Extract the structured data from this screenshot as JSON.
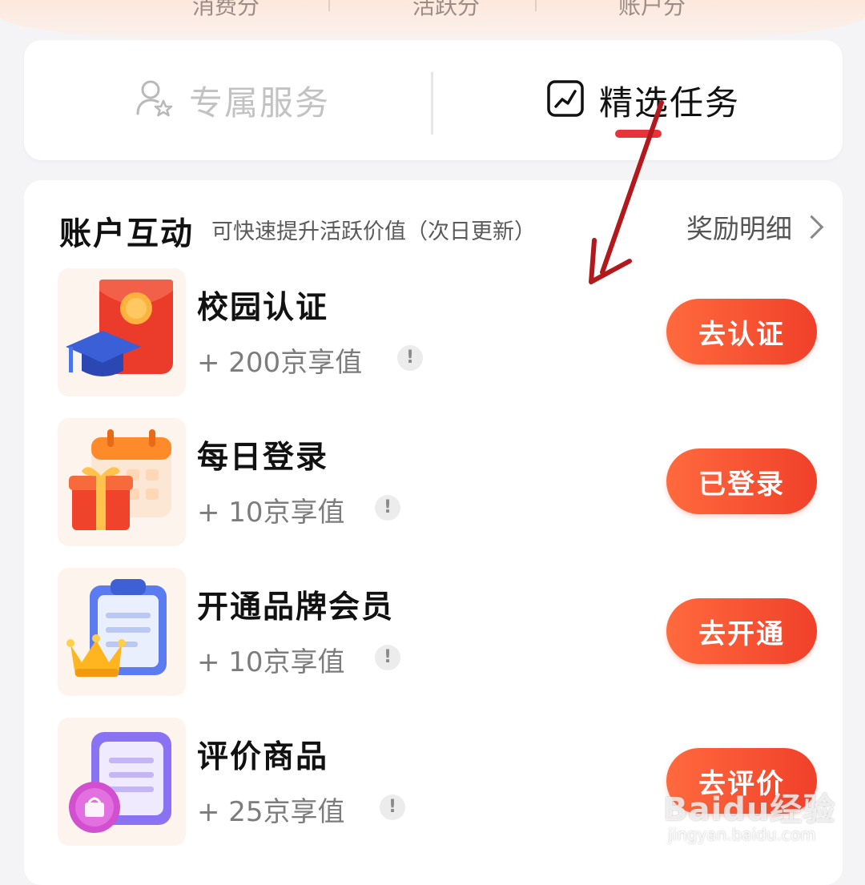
{
  "top_strip": {
    "partial_labels": [
      "消费分",
      "活跃分",
      "账户分"
    ]
  },
  "tabs": [
    {
      "label": "专属服务",
      "icon": "person-star-icon",
      "active": false
    },
    {
      "label": "精选任务",
      "icon": "chart-line-icon",
      "active": true
    }
  ],
  "section": {
    "title": "账户互动",
    "subtitle": "可快速提升活跃价值（次日更新）",
    "reward_link": "奖励明细"
  },
  "tasks": [
    {
      "title": "校园认证",
      "value": "+ 200京享值",
      "button": "去认证",
      "icon": "graduation-cap-red-envelope-icon"
    },
    {
      "title": "每日登录",
      "value": "+ 10京享值",
      "button": "已登录",
      "icon": "calendar-gift-icon"
    },
    {
      "title": "开通品牌会员",
      "value": "+ 10京享值",
      "button": "去开通",
      "icon": "clipboard-crown-icon"
    },
    {
      "title": "评价商品",
      "value": "+ 25京享值",
      "button": "去评价",
      "icon": "document-bag-badge-icon"
    }
  ],
  "watermark": {
    "main": "Baidu经验",
    "sub": "jingyan.baidu.com"
  },
  "colors": {
    "accent": "#f0402a",
    "underline": "#e8333b",
    "annotation_arrow": "#b3191c"
  }
}
